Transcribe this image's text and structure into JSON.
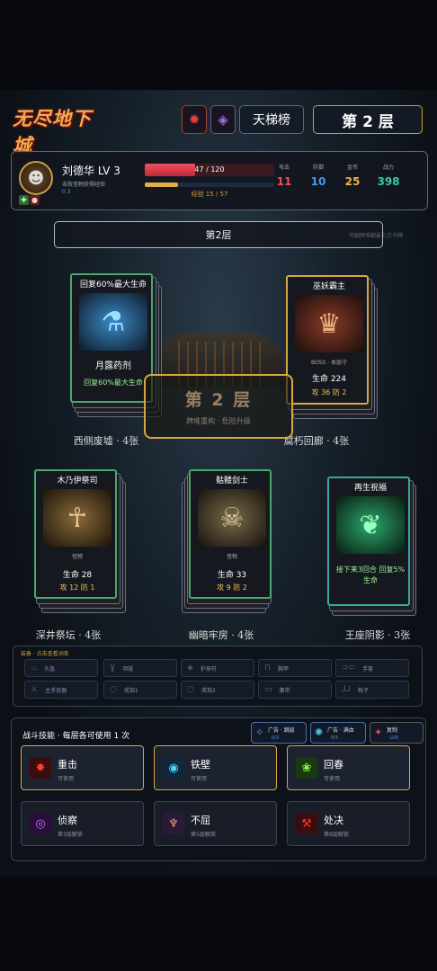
{
  "header": {
    "logo": "无尽地下城",
    "rank_label": "天梯榜",
    "floor_label": "第 2 层",
    "icon1": "red-gem-icon",
    "icon2": "purple-crystal-icon"
  },
  "player": {
    "name": "刘德华  LV 3",
    "tip": "击败怪物获得经验",
    "digit": "0.3",
    "hp_text": "47 / 120",
    "hp_fraction": 0.39,
    "xp_text": "经验 15 / 57",
    "xp_fraction": 0.26,
    "stats": [
      {
        "label": "攻击",
        "value": "11",
        "color": "#f0505a"
      },
      {
        "label": "防御",
        "value": "10",
        "color": "#4a9ae8"
      },
      {
        "label": "金币",
        "value": "25",
        "color": "#e8b840"
      },
      {
        "label": "战力",
        "value": "398",
        "color": "#3ac8a8"
      }
    ]
  },
  "floor_banner": "第2层",
  "side_hint": "可翻牌堆翻最上方卡牌",
  "floor_popup": {
    "title": "第 2 层",
    "subtitle": "牌堆重构 · 危险升级"
  },
  "cards": [
    {
      "title": "回复60%最大生命",
      "main": "月露药剂",
      "desc": "回复60%最大生命",
      "zone": "西侧废墟 · 4张",
      "color": "#4aa86a",
      "icon": "potion-icon"
    },
    {
      "title": "巫妖霸主",
      "sub": "BOSS · 本层守",
      "main": "生命 224",
      "atk": "攻 36  防 2",
      "zone": "腐朽回廊 · 4张",
      "color": "#d8a840",
      "icon": "lich-icon"
    },
    {
      "title": "木乃伊祭司",
      "sub": "怪物",
      "main": "生命 28",
      "atk": "攻 12  防 1",
      "zone": "深井祭坛 · 4张",
      "color": "#4aa86a",
      "icon": "mummy-icon"
    },
    {
      "title": "骷髅剑士",
      "sub": "怪物",
      "main": "生命 33",
      "atk": "攻 9  防 2",
      "zone": "幽暗牢房 · 4张",
      "color": "#4aa86a",
      "icon": "skeleton-icon"
    },
    {
      "title": "再生祝福",
      "main": "",
      "desc": "接下来3回合 回复5%生命",
      "zone": "王座阴影 · 3张",
      "color": "#3aa8a0",
      "icon": "blessing-icon"
    }
  ],
  "equip": {
    "title": "装备 · 点击查看词条",
    "slots": [
      "头盔",
      "项链",
      "护身符",
      "胸甲",
      "手套",
      "主手武器",
      "戒指1",
      "戒指2",
      "腰带",
      "靴子"
    ]
  },
  "skills": {
    "title": "战斗技能 · 每层各可使用 1 次",
    "ads": [
      {
        "t1": "广告 · 跳层",
        "t2": "0/3"
      },
      {
        "t1": "广告 · 满血",
        "t2": "0/3"
      },
      {
        "t1": "复制",
        "t2": "LV0"
      }
    ],
    "items": [
      {
        "name": "重击",
        "status": "可使用",
        "icon": "strike-icon",
        "state": "avail"
      },
      {
        "name": "铁壁",
        "status": "可使用",
        "icon": "iron-wall-icon",
        "state": "avail"
      },
      {
        "name": "回春",
        "status": "可使用",
        "icon": "rejuvenate-icon",
        "state": "avail"
      },
      {
        "name": "侦察",
        "status": "第3层解锁",
        "icon": "scout-icon",
        "state": "locked"
      },
      {
        "name": "不屈",
        "status": "第5层解锁",
        "icon": "unyielding-icon",
        "state": "locked"
      },
      {
        "name": "处决",
        "status": "第8层解锁",
        "icon": "execute-icon",
        "state": "locked"
      }
    ]
  }
}
